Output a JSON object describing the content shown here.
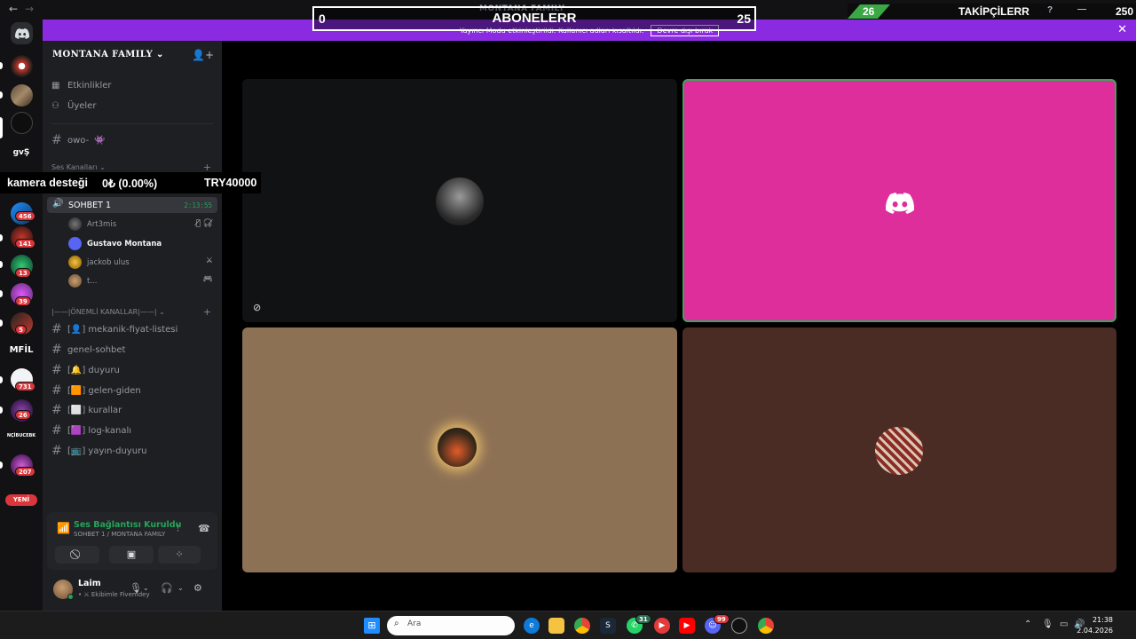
{
  "window": {
    "title": "MONTANA FAMILY"
  },
  "streamer_bar": {
    "message": "Yayıncı Modu etkinleştirildi. Kullanıcı adları kısaltıldı.",
    "disable_label": "Devre dışı bırak"
  },
  "overlays": {
    "subscribers": {
      "min": "0",
      "label": "ABONELERR",
      "max": "25"
    },
    "followers": {
      "current": "26",
      "label": "TAKİPÇİLERR",
      "max": "250",
      "progress": 0.104,
      "color": "#3aa845"
    },
    "ticker": {
      "label": "kamera desteği",
      "amount": "0₺ (0.00%)",
      "goal": "TRY40000"
    }
  },
  "rail": {
    "badges": [
      "456",
      "141",
      "13",
      "39",
      "5",
      "731",
      "26",
      "207"
    ],
    "text_servers": [
      "gvŞ",
      "MFİL",
      "NÇİBUCEBK"
    ],
    "new_label": "YENİ"
  },
  "sidebar": {
    "server_name": "MONTANA FAMILY",
    "events_label": "Etkinlikler",
    "members_label": "Üyeler",
    "owo_channel": "owo-",
    "voice_category": "Ses Kanalları",
    "voice_channel": {
      "name": "SOHBET 1",
      "time": "2:13:55"
    },
    "voice_users": [
      {
        "name": "Art3mis"
      },
      {
        "name": "Gustavo Montana"
      },
      {
        "name": "jackob ulus"
      },
      {
        "name": "t..."
      }
    ],
    "important_category": "|——|ÖNEMLİ KANALLAR|——|",
    "channels": [
      {
        "label": "[👤] mekanik-fiyat-listesi"
      },
      {
        "label": "genel-sohbet"
      },
      {
        "label": "[🔔] duyuru"
      },
      {
        "label": "[🟧] gelen-giden"
      },
      {
        "label": "[⬜] kurallar"
      },
      {
        "label": "[🟪] log-kanalı"
      },
      {
        "label": "[📺] yayın-duyuru"
      }
    ]
  },
  "voice_panel": {
    "title": "Ses Bağlantısı Kuruldu",
    "subtitle": "SOHBET 1 / MONTANA FAMILY"
  },
  "user_panel": {
    "name": "Laim",
    "status": "• ⚔ Ekibimle Fivemdey"
  },
  "stage": {
    "tile_colors": [
      "#111214",
      "#dd2e9c",
      "#8d7155",
      "#4a2c25"
    ]
  },
  "taskbar": {
    "search_placeholder": "Ara",
    "time": "21:38",
    "date": "2.04.2026",
    "whatsapp_count": "31",
    "discord_count": "99"
  }
}
